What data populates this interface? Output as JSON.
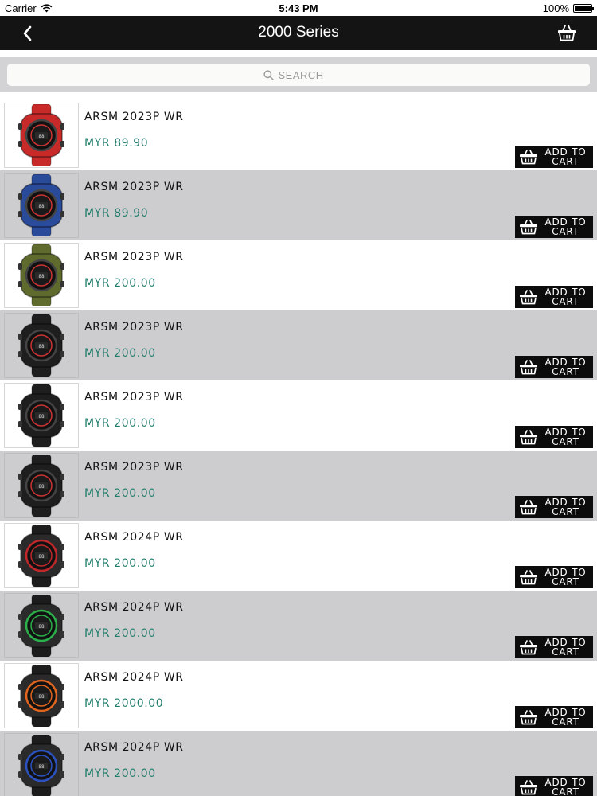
{
  "status_bar": {
    "carrier": "Carrier",
    "time": "5:43 PM",
    "battery": "100%"
  },
  "nav": {
    "title": "2000 Series",
    "back_icon": "chevron-left-icon",
    "cart_icon": "basket-icon"
  },
  "search": {
    "placeholder": "SEARCH",
    "icon": "search-icon"
  },
  "colors": {
    "nav_background": "#141414",
    "price_text": "#1f7d6a",
    "shaded_row": "#cdcdcf",
    "button_background": "#0c0c0c"
  },
  "products": [
    {
      "name": "ARSM 2023P WR",
      "price": "MYR 89.90",
      "add_label": "ADD TO CART",
      "watch_color": "#c82a2a",
      "style": "a"
    },
    {
      "name": "ARSM 2023P WR",
      "price": "MYR 89.90",
      "add_label": "ADD TO CART",
      "watch_color": "#2a4a9a",
      "style": "a"
    },
    {
      "name": "ARSM 2023P WR",
      "price": "MYR 200.00",
      "add_label": "ADD TO CART",
      "watch_color": "#5e6b2c",
      "style": "a"
    },
    {
      "name": "ARSM 2023P WR",
      "price": "MYR 200.00",
      "add_label": "ADD TO CART",
      "watch_color": "#1e1e1e",
      "style": "a"
    },
    {
      "name": "ARSM 2023P WR",
      "price": "MYR 200.00",
      "add_label": "ADD TO CART",
      "watch_color": "#1e1e1e",
      "style": "a"
    },
    {
      "name": "ARSM 2023P WR",
      "price": "MYR 200.00",
      "add_label": "ADD TO CART",
      "watch_color": "#1e1e1e",
      "style": "a"
    },
    {
      "name": "ARSM 2024P WR",
      "price": "MYR 200.00",
      "add_label": "ADD TO CART",
      "watch_color": "#c0282a",
      "style": "b"
    },
    {
      "name": "ARSM 2024P WR",
      "price": "MYR 200.00",
      "add_label": "ADD TO CART",
      "watch_color": "#2bb04a",
      "style": "b"
    },
    {
      "name": "ARSM 2024P WR",
      "price": "MYR 2000.00",
      "add_label": "ADD TO CART",
      "watch_color": "#e0651e",
      "style": "b"
    },
    {
      "name": "ARSM 2024P WR",
      "price": "MYR 200.00",
      "add_label": "ADD TO CART",
      "watch_color": "#2c52c0",
      "style": "b"
    }
  ]
}
